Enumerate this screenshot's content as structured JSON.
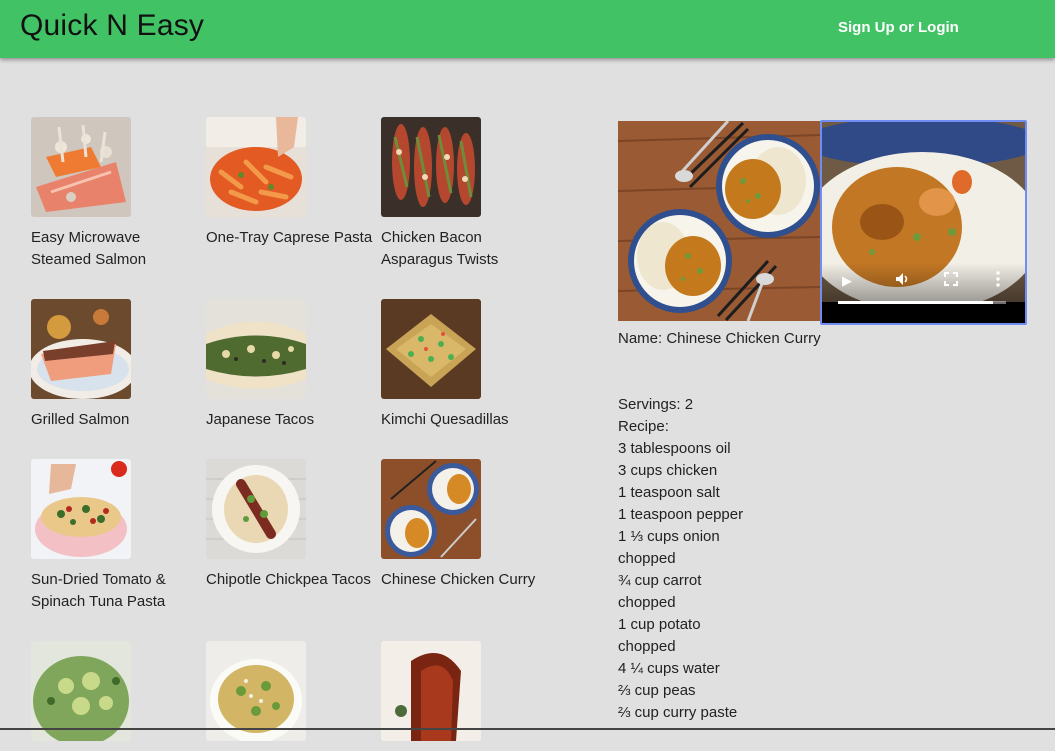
{
  "app": {
    "title": "Quick N Easy",
    "auth_link": "Sign Up or Login"
  },
  "recipes": [
    {
      "name": "Easy Microwave Steamed Salmon"
    },
    {
      "name": "One-Tray Caprese Pasta"
    },
    {
      "name": "Chicken Bacon Asparagus Twists"
    },
    {
      "name": "Grilled Salmon"
    },
    {
      "name": "Japanese Tacos"
    },
    {
      "name": "Kimchi Quesadillas"
    },
    {
      "name": "Sun-Dried Tomato & Spinach Tuna Pasta"
    },
    {
      "name": "Chipotle Chickpea Tacos"
    },
    {
      "name": "Chinese Chicken Curry"
    },
    {
      "name": ""
    },
    {
      "name": ""
    },
    {
      "name": ""
    }
  ],
  "detail": {
    "name_line": "Name: Chinese Chicken Curry",
    "servings_line": "Servings: 2",
    "recipe_label": "Recipe:",
    "ingredients": [
      "3 tablespoons oil",
      "3 cups chicken",
      "1 teaspoon salt",
      "1 teaspoon pepper",
      "1 ⅓ cups onion",
      "chopped",
      "¾ cup carrot",
      "chopped",
      "1 cup potato",
      "chopped",
      "4 ¼ cups water",
      "⅔ cup peas",
      "⅔ cup curry paste"
    ],
    "video": {
      "progress": 0.92,
      "icons": [
        "play-icon",
        "volume-icon",
        "fullscreen-icon",
        "more-options-icon"
      ]
    }
  },
  "colors": {
    "header": "#41c264",
    "background": "#e0e0e0",
    "video_focus": "#6f8df2"
  }
}
